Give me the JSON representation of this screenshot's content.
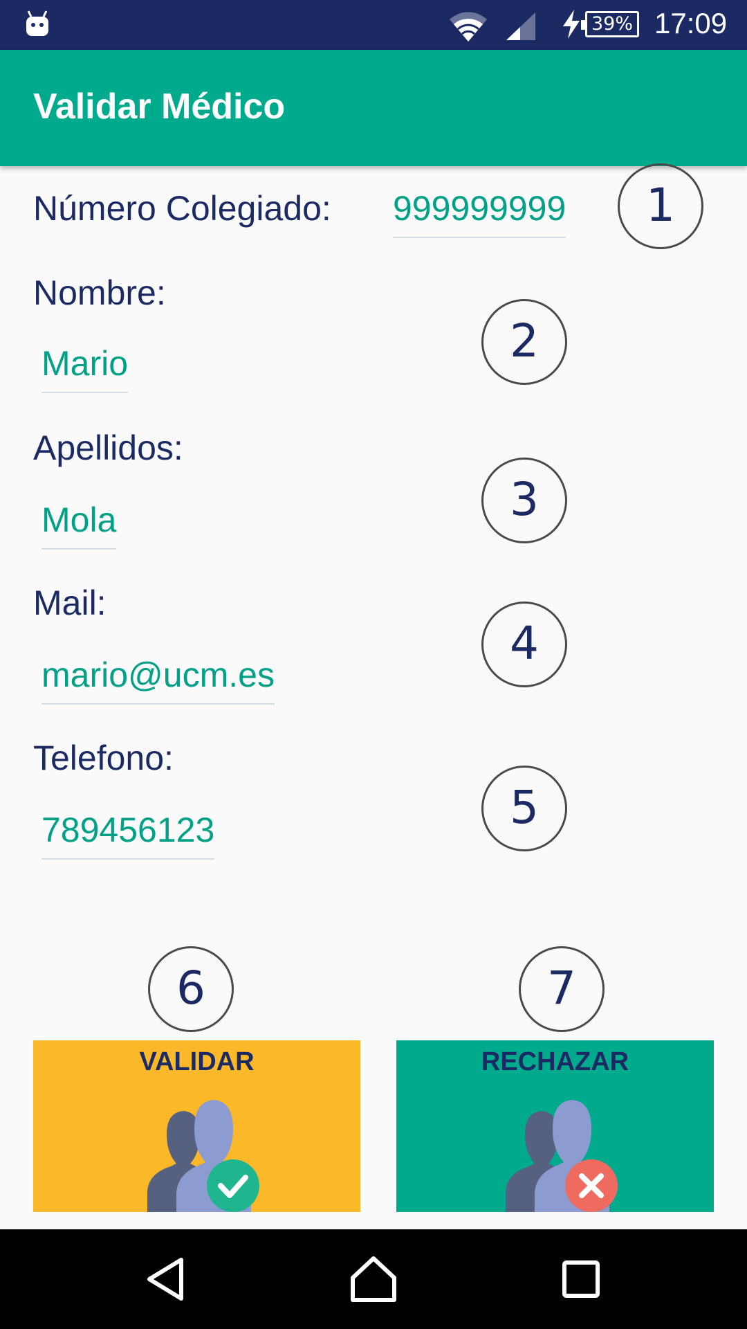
{
  "status_bar": {
    "battery": "39%",
    "time": "17:09",
    "icons": [
      "android-notification-icon",
      "wifi-icon",
      "signal-icon",
      "charging-icon",
      "battery-icon"
    ]
  },
  "app_bar": {
    "title": "Validar Médico"
  },
  "form": {
    "colegiado": {
      "label": "Número Colegiado:",
      "value": "999999999"
    },
    "nombre": {
      "label": "Nombre:",
      "value": "Mario"
    },
    "apellidos": {
      "label": "Apellidos:",
      "value": "Mola"
    },
    "mail": {
      "label": "Mail:",
      "value": "mario@ucm.es"
    },
    "telefono": {
      "label": "Telefono:",
      "value": "789456123"
    }
  },
  "annotations": [
    "1",
    "2",
    "3",
    "4",
    "5",
    "6",
    "7"
  ],
  "buttons": {
    "validar": {
      "label": "VALIDAR",
      "color": "#fbb829",
      "icon": "users-check-icon"
    },
    "rechazar": {
      "label": "RECHAZAR",
      "color": "#00ab8d",
      "icon": "users-reject-icon"
    }
  },
  "nav_bar": {
    "icons": [
      "back-icon",
      "home-icon",
      "recents-icon"
    ]
  },
  "colors": {
    "status_bar": "#1b2a63",
    "app_bar": "#00ab8d",
    "accent_text": "#00a187",
    "label_text": "#1b2a63"
  }
}
